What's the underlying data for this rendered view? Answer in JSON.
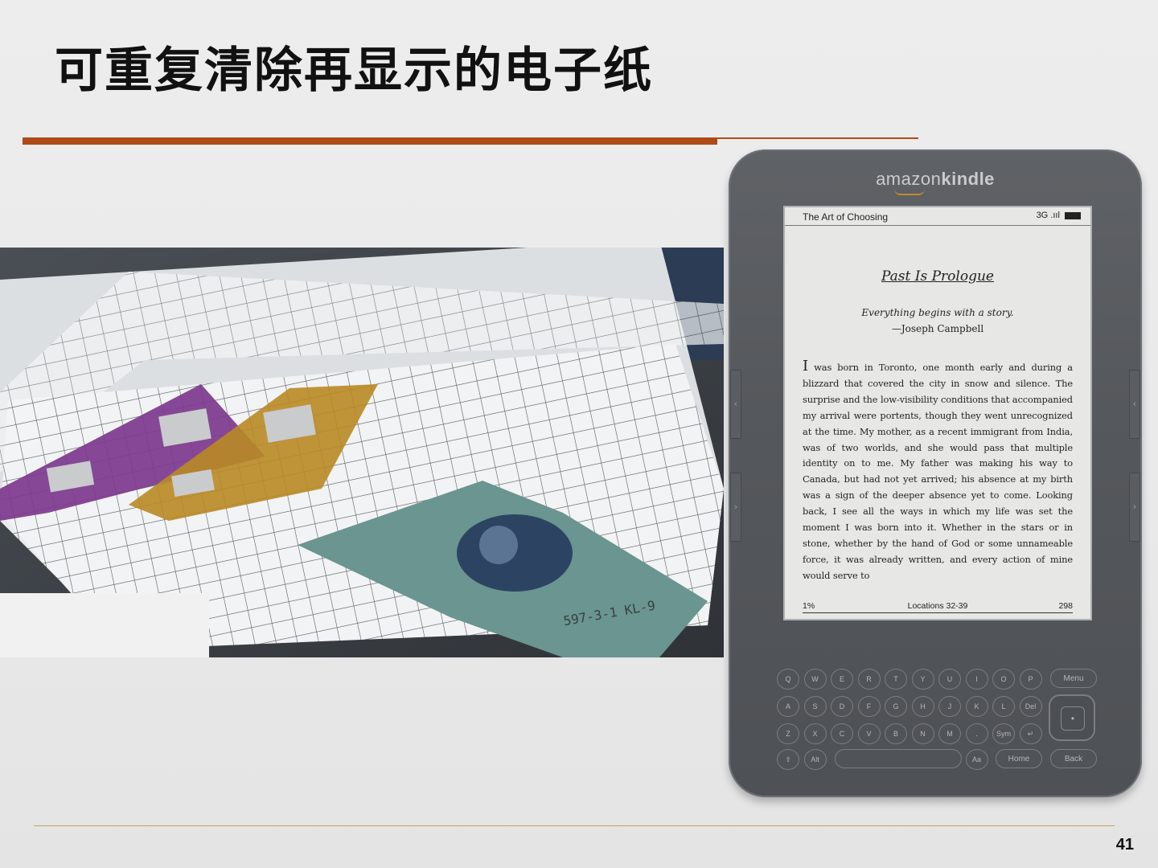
{
  "slide": {
    "title": "可重复清除再显示的电子纸",
    "page_number": "41"
  },
  "photo": {
    "label_text": "597-3-1 KL-9"
  },
  "kindle": {
    "brand_light": "amazon",
    "brand_bold": "kindle",
    "status_bar": {
      "book_title": "The Art of Choosing",
      "network": "3G",
      "signal": ".ııl"
    },
    "chapter_title": "Past Is Prologue",
    "epigraph": "Everything begins with a story.",
    "epigraph_author": "—Joseph Campbell",
    "dropcap": "I",
    "body": " was born in Toronto, one month early and during a blizzard that covered the city in snow and silence. The surprise and the low-visibility conditions that accompanied my arrival were portents, though they went unrecognized at the time. My mother, as a recent immigrant from India, was of two worlds, and she would pass that multiple identity on to me. My father was making his way to Canada, but had not yet arrived; his absence at my birth was a sign of the deeper absence yet to come. Looking back, I see all the ways in which my life was set the moment I was born into it. Whether in the stars or in stone, whether by the hand of God or some unnameable force, it was already written, and every action of mine would serve to",
    "footer": {
      "percent": "1%",
      "locations": "Locations 32-39",
      "total": "298"
    },
    "keyboard": {
      "row1": [
        "Q",
        "W",
        "E",
        "R",
        "T",
        "Y",
        "U",
        "I",
        "O",
        "P"
      ],
      "row2": [
        "A",
        "S",
        "D",
        "F",
        "G",
        "H",
        "J",
        "K",
        "L",
        "Del"
      ],
      "row3": [
        "Z",
        "X",
        "C",
        "V",
        "B",
        "N",
        "M",
        ".",
        "Sym",
        "↵"
      ],
      "row4_left": [
        "⇧",
        "Alt"
      ],
      "row4_right": [
        "Aa"
      ],
      "menu": "Menu",
      "home": "Home",
      "back": "Back",
      "select": "•"
    }
  }
}
